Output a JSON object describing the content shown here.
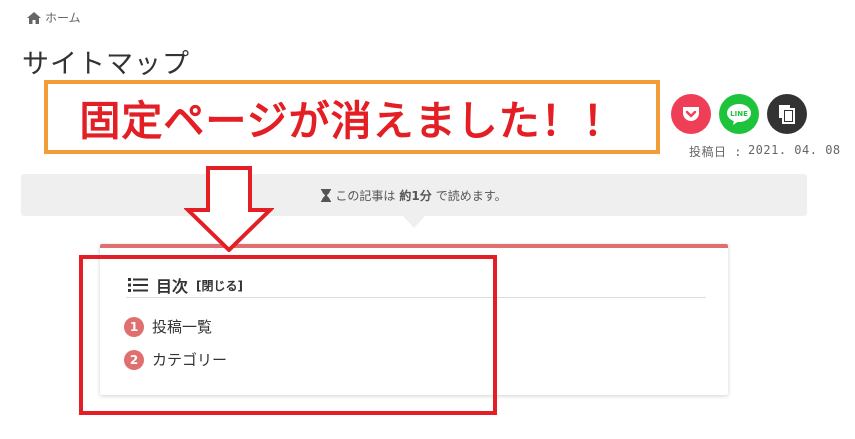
{
  "breadcrumb": {
    "icon": "home-icon",
    "label": "ホーム"
  },
  "page": {
    "title": "サイトマップ"
  },
  "annotation": {
    "text": "固定ページが消えました！！",
    "border_color": "#f39c3a",
    "text_color": "#e31e24"
  },
  "share": {
    "pocket_color": "#ef3f56",
    "line_color": "#1ec33c",
    "line_label": "LINE",
    "copy_color": "#333333"
  },
  "post_meta": {
    "date_label": "投稿日 :",
    "date": "2021. 04. 08"
  },
  "reading": {
    "icon": "hourglass-icon",
    "prefix": "この記事は",
    "time": "約1分",
    "suffix": "で読めます。"
  },
  "toc": {
    "icon": "list-icon",
    "title": "目次",
    "toggle": "[閉じる]",
    "accent_color": "#e07070",
    "items": [
      {
        "num": "1",
        "label": "投稿一覧"
      },
      {
        "num": "2",
        "label": "カテゴリー"
      }
    ]
  }
}
